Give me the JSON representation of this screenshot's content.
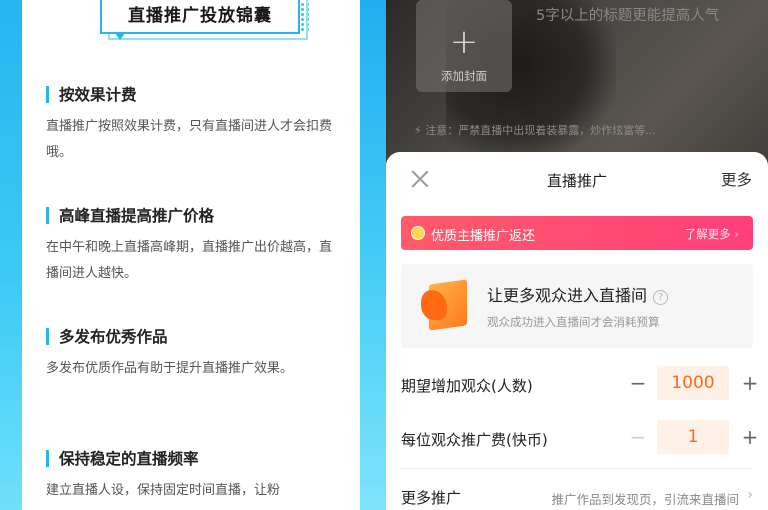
{
  "left": {
    "banner_title": "直播推广投放锦囊",
    "tips": [
      {
        "title": "按效果计费",
        "body": "直播推广按照效果计费，只有直播间进人才会扣费哦。"
      },
      {
        "title": "高峰直播提高推广价格",
        "body": "在中午和晚上直播高峰期，直播推广出价越高，直播间进人越快。"
      },
      {
        "title": "多发布优秀作品",
        "body": "多发布优质作品有助于提升直播推广效果。"
      },
      {
        "title": "保持稳定的直播频率",
        "body": "建立直播人设，保持固定时间直播，让粉"
      }
    ]
  },
  "right": {
    "cover": {
      "plus": "+",
      "label": "添加封面"
    },
    "hint": "5字以上的标题更能提高人气",
    "warning": "注意：严禁直播中出现着装暴露，炒作炫富等...",
    "sheet": {
      "title": "直播推广",
      "more": "更多",
      "promo": {
        "text": "优质主播推广返还",
        "link": "了解更多 ›"
      },
      "feature": {
        "title": "让更多观众进入直播间",
        "help": "?",
        "subtitle": "观众成功进入直播间才会消耗预算"
      },
      "expect": {
        "label": "期望增加观众(人数)",
        "minus": "−",
        "value": "1000",
        "plus": "+"
      },
      "fee": {
        "label": "每位观众推广费(快币)",
        "minus": "−",
        "value": "1",
        "plus": "+"
      },
      "more_promo": {
        "label": "更多推广",
        "value": "推广作品到发现页，引流来直播间",
        "chevron": "›"
      }
    }
  },
  "colors": {
    "accent_blue": "#27b7ee",
    "promo_red": "#ff4a72",
    "stepper_orange": "#ff6a1a"
  }
}
